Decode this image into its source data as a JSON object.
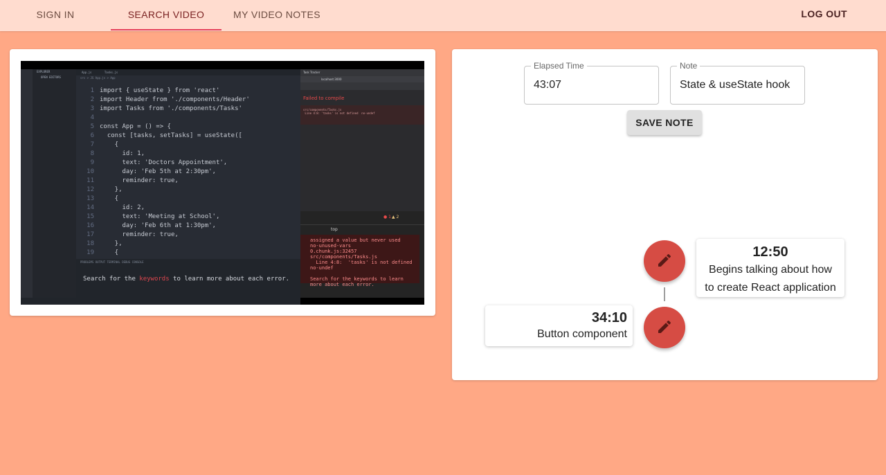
{
  "nav": {
    "tabs": [
      {
        "label": "SIGN IN"
      },
      {
        "label": "SEARCH VIDEO"
      },
      {
        "label": "MY VIDEO NOTES"
      }
    ],
    "active_tab": "SEARCH VIDEO",
    "logout_label": "LOG OUT"
  },
  "video": {
    "explorer_header": "EXPLORER",
    "explorer_items": [
      "OPEN EDITORS",
      "REACT-TASK-TRACKER",
      "node_modules",
      "public",
      "src",
      "components",
      "Button.js",
      "Header.js",
      "Tasks.js",
      "App.js",
      "index.css",
      "index.js",
      "reportWebVitals.js",
      "setupTests.js",
      ".gitignore",
      "package.json",
      "README.md",
      "yarn.lock"
    ],
    "editor_tabs": [
      "App.js",
      "Tasks.js"
    ],
    "breadcrumb": "src > JS App.js > App",
    "code_lines": [
      {
        "num": "1",
        "text": "import { useState } from 'react'"
      },
      {
        "num": "2",
        "text": "import Header from './components/Header'"
      },
      {
        "num": "3",
        "text": "import Tasks from './components/Tasks'"
      },
      {
        "num": "4",
        "text": ""
      },
      {
        "num": "5",
        "text": "const App = () => {"
      },
      {
        "num": "6",
        "text": "  const [tasks, setTasks] = useState(["
      },
      {
        "num": "7",
        "text": "    {"
      },
      {
        "num": "8",
        "text": "      id: 1,"
      },
      {
        "num": "9",
        "text": "      text: 'Doctors Appointment',"
      },
      {
        "num": "10",
        "text": "      day: 'Feb 5th at 2:30pm',"
      },
      {
        "num": "11",
        "text": "      reminder: true,"
      },
      {
        "num": "12",
        "text": "    },"
      },
      {
        "num": "13",
        "text": "    {"
      },
      {
        "num": "14",
        "text": "      id: 2,"
      },
      {
        "num": "15",
        "text": "      text: 'Meeting at School',"
      },
      {
        "num": "16",
        "text": "      day: 'Feb 6th at 1:30pm',"
      },
      {
        "num": "17",
        "text": "      reminder: true,"
      },
      {
        "num": "18",
        "text": "    },"
      },
      {
        "num": "19",
        "text": "    {"
      }
    ],
    "terminal_tabs": "PROBLEMS   OUTPUT   TERMINAL   DEBUG CONSOLE",
    "terminal_before": "Search for the ",
    "terminal_keyword": "keywords",
    "terminal_after": " to learn more about each error.",
    "browser_tab": "Task Tracker",
    "browser_url": "localhost:3000",
    "browser_failed": "Failed to compile",
    "browser_error": "src/components/Tasks.js\n Line 4:8: 'tasks' is not defined  no-undef",
    "console_top": "top",
    "console_errors": "1",
    "console_warnings": "2",
    "console_lines": [
      "assigned a value but never used",
      "no-unused-vars",
      "0.chunk.js:32457",
      "src/components/Tasks.js",
      "  Line 4:8:  'tasks' is not defined",
      "no-undef",
      "",
      "Search for the keywords to learn",
      "more about each error."
    ]
  },
  "form": {
    "elapsed_label": "Elapsed Time",
    "elapsed_value": "43:07",
    "note_label": "Note",
    "note_value": "State & useState hook",
    "save_label": "SAVE NOTE"
  },
  "timeline": [
    {
      "time": "12:50",
      "text_line1": "Begins talking about how",
      "text_line2": "to create React application"
    },
    {
      "time": "34:10",
      "text_line1": "Button component"
    }
  ],
  "colors": {
    "background": "#FFA885",
    "appbar": "#FFDCCF",
    "tab_indicator": "#e5405a",
    "fab": "#d64c44"
  },
  "icons": {
    "fab": "edit-pencil-icon"
  }
}
